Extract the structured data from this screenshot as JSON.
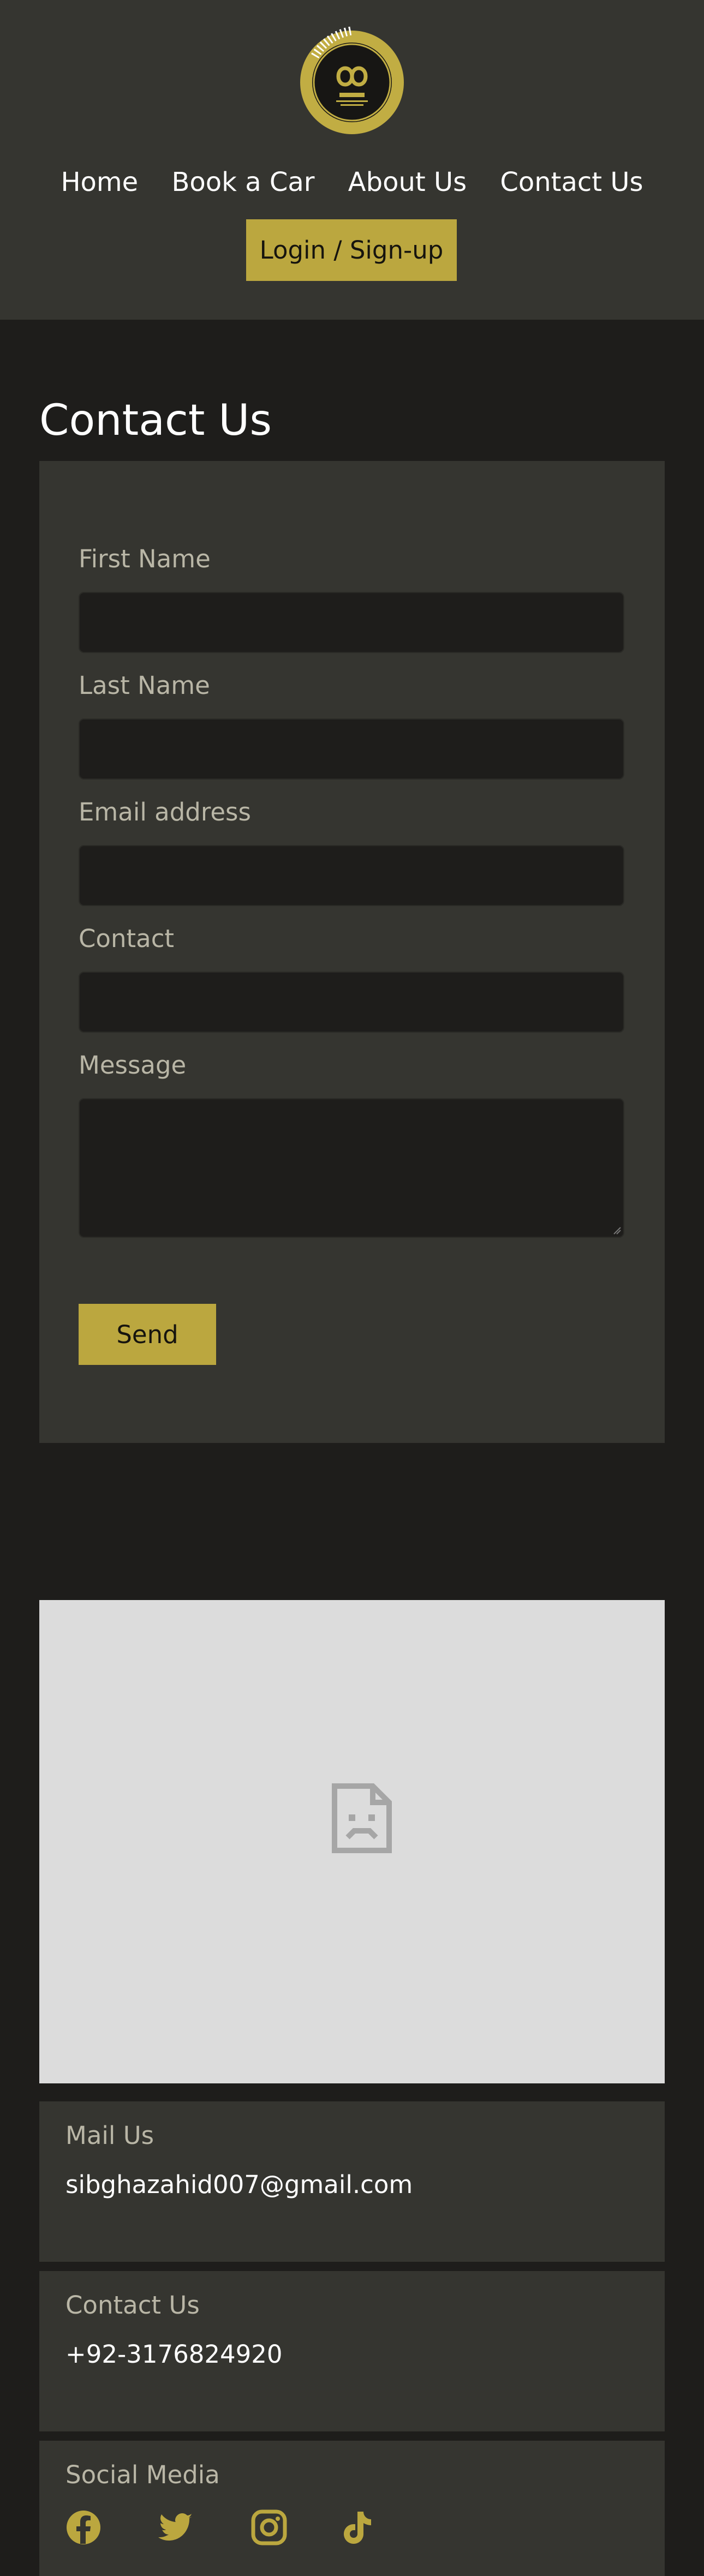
{
  "nav": {
    "items": [
      "Home",
      "Book a Car",
      "About Us",
      "Contact Us"
    ],
    "login_label": "Login / Sign-up"
  },
  "page": {
    "title": "Contact Us"
  },
  "form": {
    "first_name_label": "First Name",
    "last_name_label": "Last Name",
    "email_label": "Email address",
    "contact_label": "Contact",
    "message_label": "Message",
    "send_label": "Send"
  },
  "mail": {
    "title": "Mail Us",
    "value": "sibghazahid007@gmail.com"
  },
  "phone": {
    "title": "Contact Us",
    "value": "+92-3176824920"
  },
  "social": {
    "title": "Social Media",
    "icons": [
      "facebook-icon",
      "twitter-icon",
      "instagram-icon",
      "tiktok-icon"
    ]
  },
  "colors": {
    "header_bg": "#353530",
    "page_bg": "#1e1d1b",
    "accent_gold": "#bba73f",
    "label_text": "#b9b6a6",
    "map_placeholder": "#dcdcdc"
  }
}
